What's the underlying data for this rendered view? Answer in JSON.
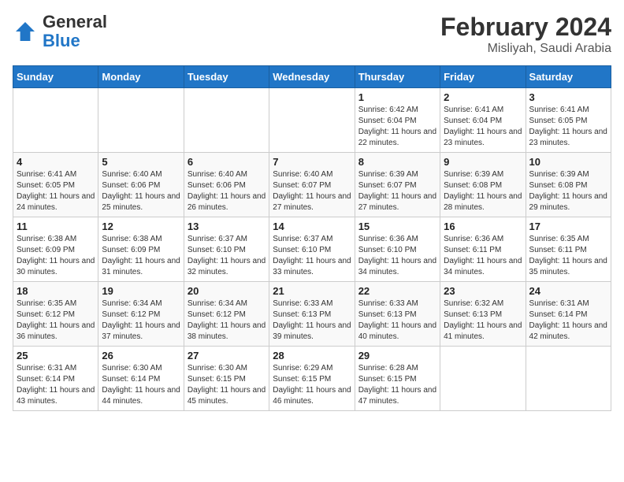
{
  "header": {
    "logo_line1": "General",
    "logo_line2": "Blue",
    "main_title": "February 2024",
    "subtitle": "Misliyah, Saudi Arabia"
  },
  "days_of_week": [
    "Sunday",
    "Monday",
    "Tuesday",
    "Wednesday",
    "Thursday",
    "Friday",
    "Saturday"
  ],
  "weeks": [
    [
      {
        "day": "",
        "info": ""
      },
      {
        "day": "",
        "info": ""
      },
      {
        "day": "",
        "info": ""
      },
      {
        "day": "",
        "info": ""
      },
      {
        "day": "1",
        "info": "Sunrise: 6:42 AM\nSunset: 6:04 PM\nDaylight: 11 hours and 22 minutes."
      },
      {
        "day": "2",
        "info": "Sunrise: 6:41 AM\nSunset: 6:04 PM\nDaylight: 11 hours and 23 minutes."
      },
      {
        "day": "3",
        "info": "Sunrise: 6:41 AM\nSunset: 6:05 PM\nDaylight: 11 hours and 23 minutes."
      }
    ],
    [
      {
        "day": "4",
        "info": "Sunrise: 6:41 AM\nSunset: 6:05 PM\nDaylight: 11 hours and 24 minutes."
      },
      {
        "day": "5",
        "info": "Sunrise: 6:40 AM\nSunset: 6:06 PM\nDaylight: 11 hours and 25 minutes."
      },
      {
        "day": "6",
        "info": "Sunrise: 6:40 AM\nSunset: 6:06 PM\nDaylight: 11 hours and 26 minutes."
      },
      {
        "day": "7",
        "info": "Sunrise: 6:40 AM\nSunset: 6:07 PM\nDaylight: 11 hours and 27 minutes."
      },
      {
        "day": "8",
        "info": "Sunrise: 6:39 AM\nSunset: 6:07 PM\nDaylight: 11 hours and 27 minutes."
      },
      {
        "day": "9",
        "info": "Sunrise: 6:39 AM\nSunset: 6:08 PM\nDaylight: 11 hours and 28 minutes."
      },
      {
        "day": "10",
        "info": "Sunrise: 6:39 AM\nSunset: 6:08 PM\nDaylight: 11 hours and 29 minutes."
      }
    ],
    [
      {
        "day": "11",
        "info": "Sunrise: 6:38 AM\nSunset: 6:09 PM\nDaylight: 11 hours and 30 minutes."
      },
      {
        "day": "12",
        "info": "Sunrise: 6:38 AM\nSunset: 6:09 PM\nDaylight: 11 hours and 31 minutes."
      },
      {
        "day": "13",
        "info": "Sunrise: 6:37 AM\nSunset: 6:10 PM\nDaylight: 11 hours and 32 minutes."
      },
      {
        "day": "14",
        "info": "Sunrise: 6:37 AM\nSunset: 6:10 PM\nDaylight: 11 hours and 33 minutes."
      },
      {
        "day": "15",
        "info": "Sunrise: 6:36 AM\nSunset: 6:10 PM\nDaylight: 11 hours and 34 minutes."
      },
      {
        "day": "16",
        "info": "Sunrise: 6:36 AM\nSunset: 6:11 PM\nDaylight: 11 hours and 34 minutes."
      },
      {
        "day": "17",
        "info": "Sunrise: 6:35 AM\nSunset: 6:11 PM\nDaylight: 11 hours and 35 minutes."
      }
    ],
    [
      {
        "day": "18",
        "info": "Sunrise: 6:35 AM\nSunset: 6:12 PM\nDaylight: 11 hours and 36 minutes."
      },
      {
        "day": "19",
        "info": "Sunrise: 6:34 AM\nSunset: 6:12 PM\nDaylight: 11 hours and 37 minutes."
      },
      {
        "day": "20",
        "info": "Sunrise: 6:34 AM\nSunset: 6:12 PM\nDaylight: 11 hours and 38 minutes."
      },
      {
        "day": "21",
        "info": "Sunrise: 6:33 AM\nSunset: 6:13 PM\nDaylight: 11 hours and 39 minutes."
      },
      {
        "day": "22",
        "info": "Sunrise: 6:33 AM\nSunset: 6:13 PM\nDaylight: 11 hours and 40 minutes."
      },
      {
        "day": "23",
        "info": "Sunrise: 6:32 AM\nSunset: 6:13 PM\nDaylight: 11 hours and 41 minutes."
      },
      {
        "day": "24",
        "info": "Sunrise: 6:31 AM\nSunset: 6:14 PM\nDaylight: 11 hours and 42 minutes."
      }
    ],
    [
      {
        "day": "25",
        "info": "Sunrise: 6:31 AM\nSunset: 6:14 PM\nDaylight: 11 hours and 43 minutes."
      },
      {
        "day": "26",
        "info": "Sunrise: 6:30 AM\nSunset: 6:14 PM\nDaylight: 11 hours and 44 minutes."
      },
      {
        "day": "27",
        "info": "Sunrise: 6:30 AM\nSunset: 6:15 PM\nDaylight: 11 hours and 45 minutes."
      },
      {
        "day": "28",
        "info": "Sunrise: 6:29 AM\nSunset: 6:15 PM\nDaylight: 11 hours and 46 minutes."
      },
      {
        "day": "29",
        "info": "Sunrise: 6:28 AM\nSunset: 6:15 PM\nDaylight: 11 hours and 47 minutes."
      },
      {
        "day": "",
        "info": ""
      },
      {
        "day": "",
        "info": ""
      }
    ]
  ]
}
